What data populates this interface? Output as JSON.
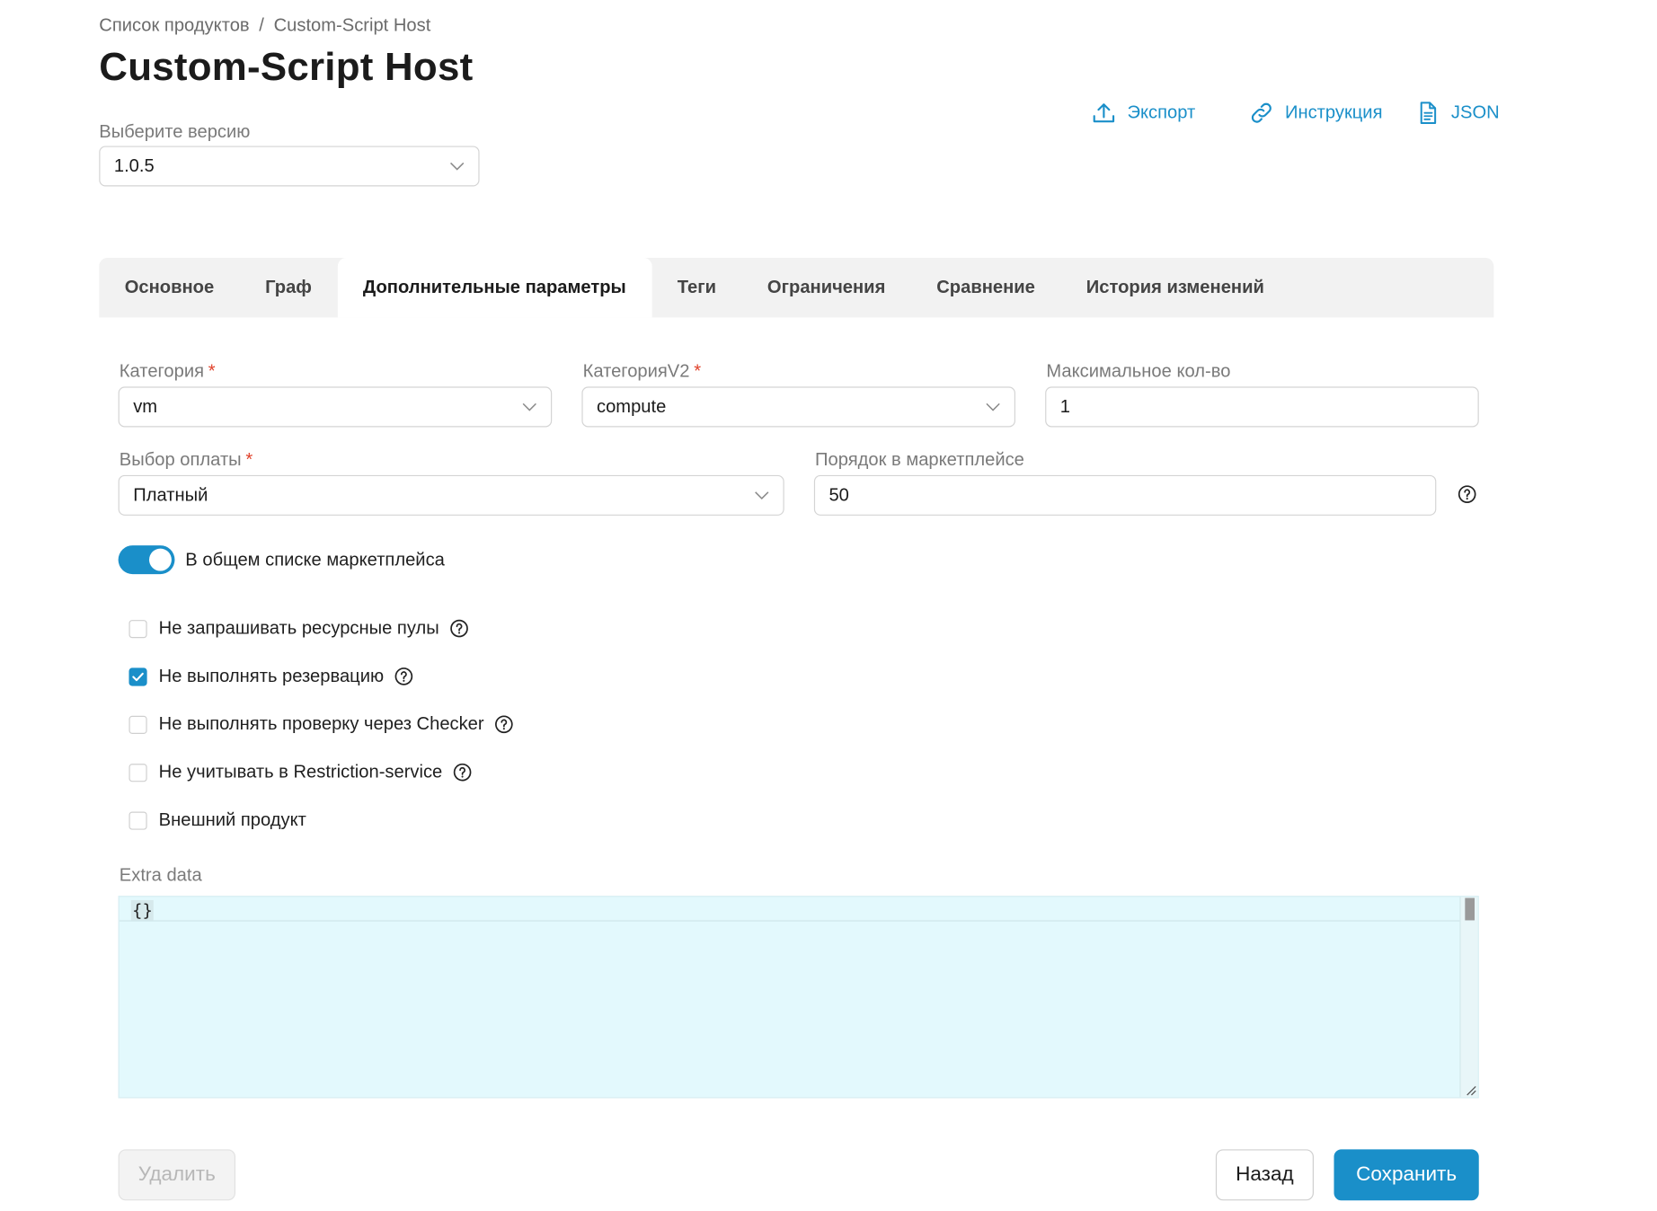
{
  "breadcrumb": {
    "root": "Список продуктов",
    "separator": "/",
    "current": "Custom-Script Host"
  },
  "page_title": "Custom-Script Host",
  "version": {
    "label": "Выберите версию",
    "value": "1.0.5"
  },
  "top_links": [
    {
      "label": "Экспорт",
      "icon": "upload-icon"
    },
    {
      "label": "Инструкция",
      "icon": "link-icon"
    },
    {
      "label": "JSON",
      "icon": "document-icon"
    }
  ],
  "tabs": [
    {
      "label": "Основное",
      "active": false
    },
    {
      "label": "Граф",
      "active": false
    },
    {
      "label": "Дополнительные параметры",
      "active": true
    },
    {
      "label": "Теги",
      "active": false
    },
    {
      "label": "Ограничения",
      "active": false
    },
    {
      "label": "Сравнение",
      "active": false
    },
    {
      "label": "История изменений",
      "active": false
    }
  ],
  "form": {
    "category": {
      "label": "Категория",
      "required_mark": "*",
      "value": "vm"
    },
    "category_v2": {
      "label": "КатегорияV2",
      "required_mark": "*",
      "value": "compute"
    },
    "max_count": {
      "label": "Максимальное кол-во",
      "value": "1"
    },
    "payment": {
      "label": "Выбор оплаты",
      "required_mark": "*",
      "value": "Платный"
    },
    "marketplace_order": {
      "label": "Порядок в маркетплейсе",
      "value": "50"
    },
    "toggle": {
      "label": "В общем списке маркетплейса",
      "on": true
    },
    "checkboxes": [
      {
        "label": "Не запрашивать ресурсные пулы",
        "checked": false,
        "help": true
      },
      {
        "label": "Не выполнять резервацию",
        "checked": true,
        "help": true
      },
      {
        "label": "Не выполнять проверку через Checker",
        "checked": false,
        "help": true
      },
      {
        "label": "Не учитывать в Restriction-service",
        "checked": false,
        "help": true
      },
      {
        "label": "Внешний продукт",
        "checked": false,
        "help": false
      }
    ],
    "extra_data": {
      "label": "Extra data",
      "value": "{}"
    }
  },
  "actions": {
    "delete": "Удалить",
    "back": "Назад",
    "save": "Сохранить"
  },
  "colors": {
    "accent": "#1a8fc9",
    "required": "#e0412a",
    "editor_bg": "#e3f9fd",
    "tabs_bg": "#f2f2f2"
  }
}
